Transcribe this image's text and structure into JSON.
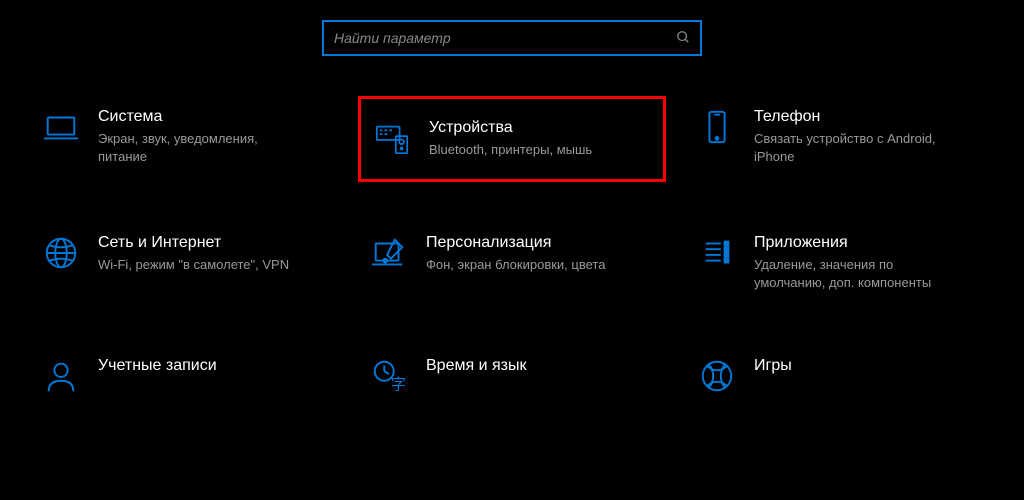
{
  "search": {
    "placeholder": "Найти параметр"
  },
  "categories": [
    {
      "title": "Система",
      "desc": "Экран, звук, уведомления, питание"
    },
    {
      "title": "Устройства",
      "desc": "Bluetooth, принтеры, мышь"
    },
    {
      "title": "Телефон",
      "desc": "Связать устройство с Android, iPhone"
    },
    {
      "title": "Сеть и Интернет",
      "desc": "Wi-Fi, режим \"в самолете\", VPN"
    },
    {
      "title": "Персонализация",
      "desc": "Фон, экран блокировки, цвета"
    },
    {
      "title": "Приложения",
      "desc": "Удаление, значения по умолчанию, доп. компоненты"
    },
    {
      "title": "Учетные записи",
      "desc": ""
    },
    {
      "title": "Время и язык",
      "desc": ""
    },
    {
      "title": "Игры",
      "desc": ""
    }
  ]
}
